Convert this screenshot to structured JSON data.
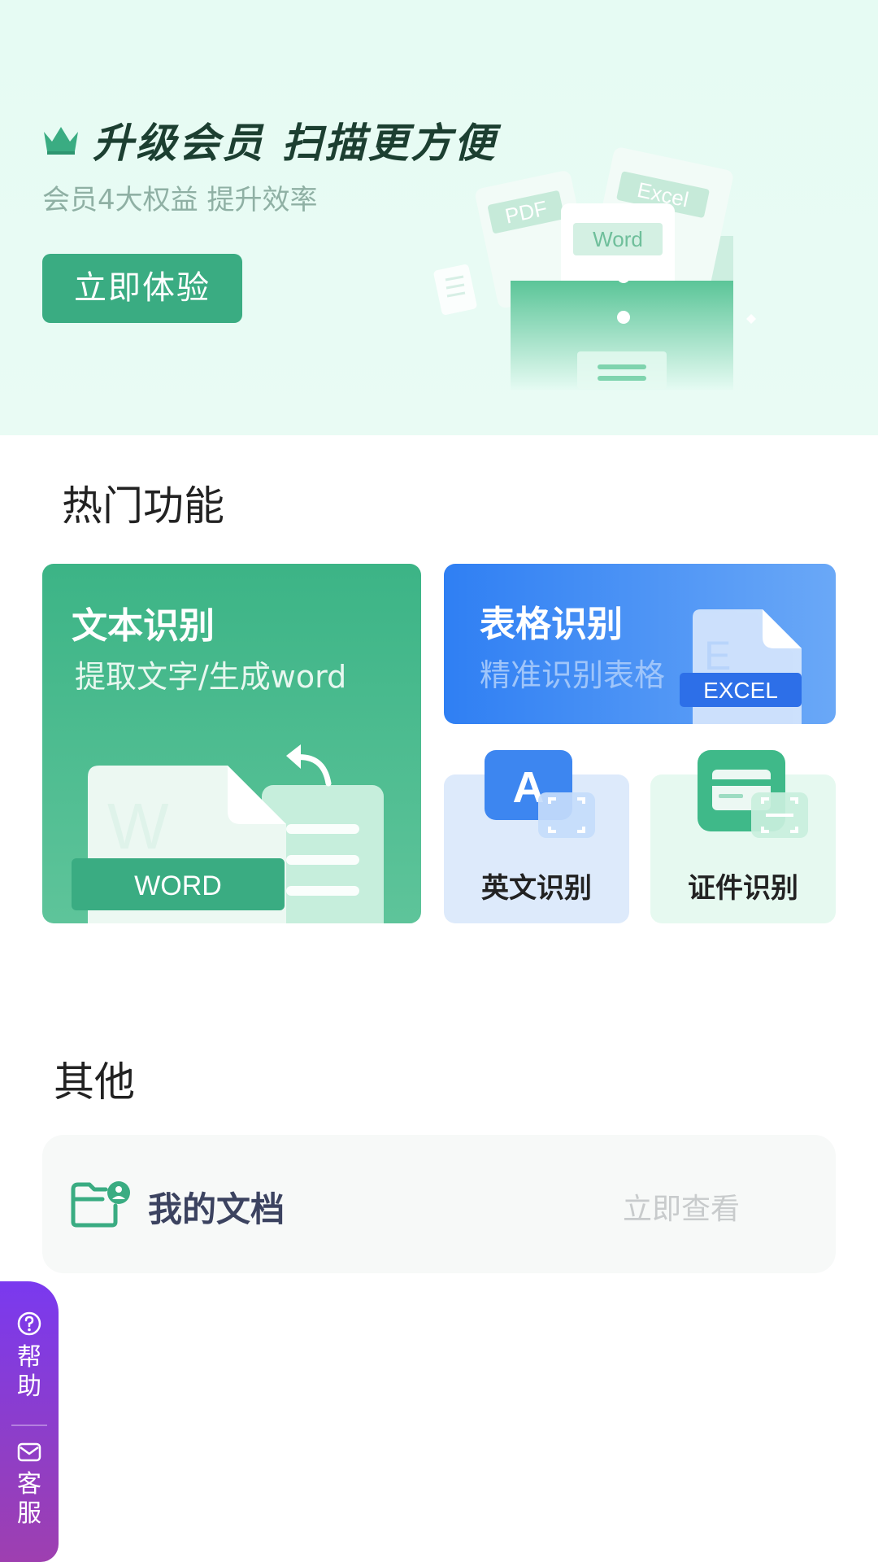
{
  "banner": {
    "title": "升级会员 扫描更方便",
    "subtitle": "会员4大权益 提升效率",
    "cta": "立即体验",
    "art_labels": {
      "pdf": "PDF",
      "excel": "Excel",
      "word": "Word"
    }
  },
  "hot": {
    "section_title": "热门功能",
    "text_recognition": {
      "title": "文本识别",
      "subtitle": "提取文字/生成word",
      "badge": "WORD",
      "watermark": "W"
    },
    "table_recognition": {
      "title": "表格识别",
      "subtitle": "精准识别表格",
      "badge": "EXCEL",
      "watermark": "E"
    },
    "english_recognition": {
      "label": "英文识别",
      "icon_letter": "A"
    },
    "id_recognition": {
      "label": "证件识别"
    }
  },
  "other": {
    "section_title": "其他",
    "my_docs": {
      "label": "我的文档",
      "link": "立即查看"
    }
  },
  "floating": {
    "help": "帮助",
    "service": "客服"
  },
  "colors": {
    "brand_green": "#3aac82",
    "banner_bg": "#e6fbf3",
    "blue": "#2f7ff3",
    "purple": "#7a39ef"
  },
  "icons": [
    "crown-icon",
    "my-docs-icon",
    "help-icon",
    "mail-icon",
    "scan-frame-icon",
    "id-card-icon"
  ]
}
